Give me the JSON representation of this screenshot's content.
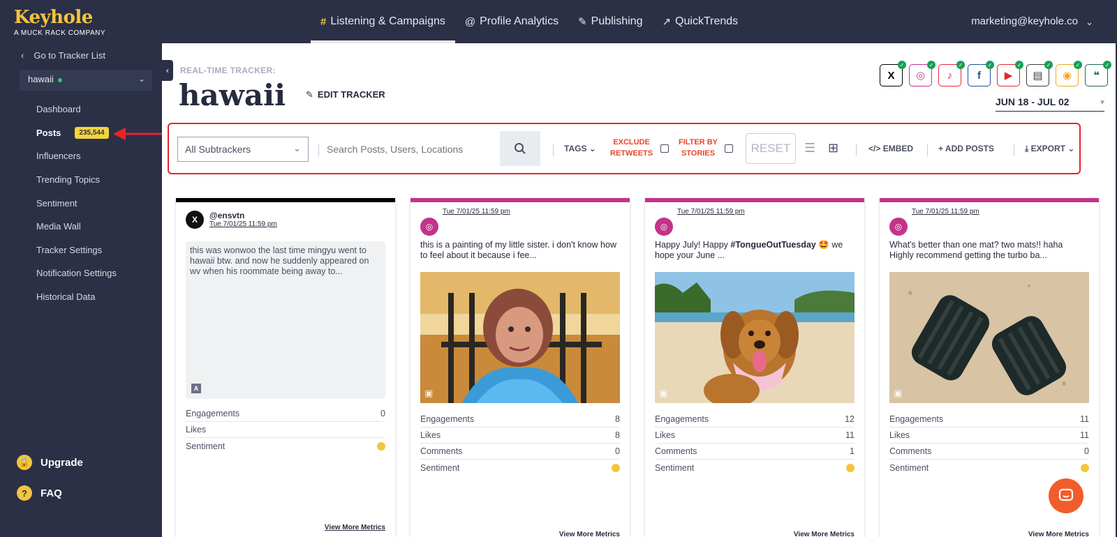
{
  "brand": {
    "name": "Keyhole",
    "sub": "A MUCK RACK COMPANY"
  },
  "nav": [
    {
      "icon": "#",
      "label": "Listening & Campaigns",
      "active": true
    },
    {
      "icon": "@",
      "label": "Profile Analytics",
      "active": false
    },
    {
      "icon": "✎",
      "label": "Publishing",
      "active": false
    },
    {
      "icon": "↗",
      "label": "QuickTrends",
      "active": false
    }
  ],
  "user": {
    "email": "marketing@keyhole.co"
  },
  "sidebar": {
    "back": "Go to Tracker List",
    "tracker": "hawaii",
    "items": [
      {
        "label": "Dashboard"
      },
      {
        "label": "Posts",
        "badge": "235,544",
        "active": true
      },
      {
        "label": "Influencers"
      },
      {
        "label": "Trending Topics"
      },
      {
        "label": "Sentiment"
      },
      {
        "label": "Media Wall"
      },
      {
        "label": "Tracker Settings"
      },
      {
        "label": "Notification Settings"
      },
      {
        "label": "Historical Data"
      }
    ],
    "upgrade": "Upgrade",
    "faq": "FAQ"
  },
  "header": {
    "label": "REAL-TIME TRACKER:",
    "title": "hawaii",
    "edit": "EDIT TRACKER",
    "date_range": "JUN 18 - JUL 02"
  },
  "networks": [
    {
      "name": "x-icon",
      "glyph": "X",
      "color": "#000000"
    },
    {
      "name": "instagram-icon",
      "glyph": "◎",
      "color": "#c2338a"
    },
    {
      "name": "tiktok-icon",
      "glyph": "♪",
      "color": "#e8243c"
    },
    {
      "name": "facebook-icon",
      "glyph": "f",
      "color": "#1f4f9c"
    },
    {
      "name": "youtube-icon",
      "glyph": "▶",
      "color": "#e8242a"
    },
    {
      "name": "news-icon",
      "glyph": "▤",
      "color": "#3b3b3b"
    },
    {
      "name": "rss-icon",
      "glyph": "◉",
      "color": "#f5a523"
    },
    {
      "name": "forums-icon",
      "glyph": "❝",
      "color": "#1b6b5e"
    }
  ],
  "filters": {
    "subtrackers": "All Subtrackers",
    "search_placeholder": "Search Posts, Users, Locations",
    "tags": "TAGS",
    "exclude_1": "EXCLUDE",
    "exclude_2": "RETWEETS",
    "filter_1": "FILTER BY",
    "filter_2": "STORIES",
    "reset": "RESET",
    "embed": "EMBED",
    "add_posts": "ADD POSTS",
    "export": "EXPORT"
  },
  "posts": [
    {
      "platform": "x",
      "color": "#000000",
      "handle": "@ensvtn",
      "time": "Tue 7/01/25 11:59 pm",
      "text": "this was wonwoo the last time mingyu went to hawaii btw. and now he suddenly appeared on wv when his roommate being away to...",
      "metrics": [
        {
          "label": "Engagements",
          "value": "0"
        },
        {
          "label": "Likes",
          "value": ""
        },
        {
          "label": "Sentiment",
          "value": ""
        }
      ],
      "more": "View More Metrics"
    },
    {
      "platform": "instagram",
      "color": "#c2338a",
      "time": "Tue 7/01/25 11:59 pm",
      "text": "this is a painting of my little sister. i don't know how to feel about it because i fee...",
      "metrics": [
        {
          "label": "Engagements",
          "value": "8"
        },
        {
          "label": "Likes",
          "value": "8"
        },
        {
          "label": "Comments",
          "value": "0"
        },
        {
          "label": "Sentiment",
          "value": ""
        }
      ],
      "more": "View More Metrics"
    },
    {
      "platform": "instagram",
      "color": "#c2338a",
      "time": "Tue 7/01/25 11:59 pm",
      "text_pre": "Happy July! Happy ",
      "text_tag": "#TongueOutTuesday",
      "text_post": " 🤩 we hope your June ...",
      "metrics": [
        {
          "label": "Engagements",
          "value": "12"
        },
        {
          "label": "Likes",
          "value": "11"
        },
        {
          "label": "Comments",
          "value": "1"
        },
        {
          "label": "Sentiment",
          "value": ""
        }
      ],
      "more": "View More Metrics"
    },
    {
      "platform": "instagram",
      "color": "#c2338a",
      "time": "Tue 7/01/25 11:59 pm",
      "text": "What's better than one mat? two mats!! haha Highly recommend getting the turbo ba...",
      "metrics": [
        {
          "label": "Engagements",
          "value": "11"
        },
        {
          "label": "Likes",
          "value": "11"
        },
        {
          "label": "Comments",
          "value": "0"
        },
        {
          "label": "Sentiment",
          "value": ""
        }
      ],
      "more": "View More Metrics"
    }
  ]
}
